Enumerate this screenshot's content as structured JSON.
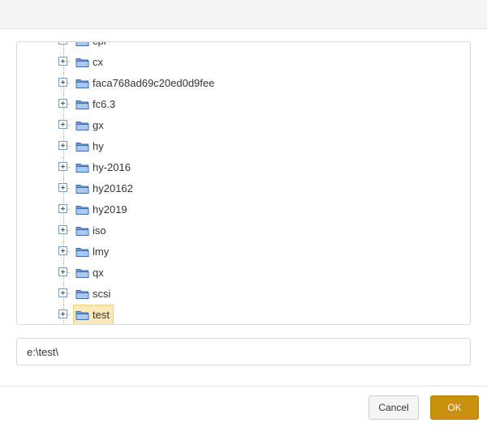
{
  "dialog": {
    "title": ""
  },
  "tree": {
    "nodes": [
      {
        "label": "cpr",
        "selected": false
      },
      {
        "label": "cx",
        "selected": false
      },
      {
        "label": "faca768ad69c20ed0d9fee",
        "selected": false
      },
      {
        "label": "fc6.3",
        "selected": false
      },
      {
        "label": "gx",
        "selected": false
      },
      {
        "label": "hy",
        "selected": false
      },
      {
        "label": "hy-2016",
        "selected": false
      },
      {
        "label": "hy20162",
        "selected": false
      },
      {
        "label": "hy2019",
        "selected": false
      },
      {
        "label": "iso",
        "selected": false
      },
      {
        "label": "lmy",
        "selected": false
      },
      {
        "label": "qx",
        "selected": false
      },
      {
        "label": "scsi",
        "selected": false
      },
      {
        "label": "test",
        "selected": true
      }
    ]
  },
  "path_field": {
    "value": "e:\\test\\"
  },
  "footer": {
    "cancel_label": "Cancel",
    "ok_label": "OK"
  },
  "colors": {
    "ok_button": "#c9900b",
    "selected_node_bg": "#fbe9b7",
    "folder_fill": "#8fb6e8"
  },
  "icons": {
    "folder": "folder-icon",
    "expander": "plus-box-icon"
  }
}
